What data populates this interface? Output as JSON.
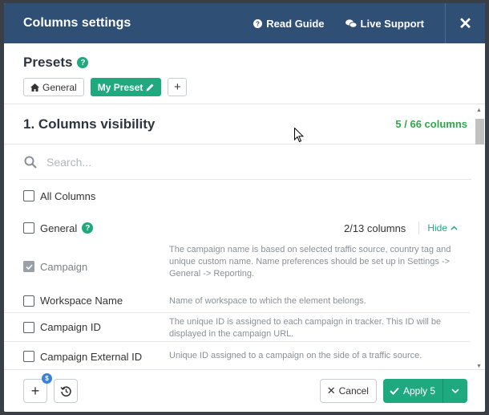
{
  "header": {
    "title": "Columns settings",
    "read_guide": "Read Guide",
    "live_support": "Live Support",
    "close": "✕"
  },
  "presets": {
    "title": "Presets",
    "help": "?",
    "items": [
      {
        "label": "General"
      },
      {
        "label": "My Preset"
      }
    ],
    "add": "+"
  },
  "visibility": {
    "title": "1. Columns visibility",
    "count": "5 / 66 columns",
    "search_placeholder": "Search...",
    "all_columns": "All Columns",
    "group": {
      "label": "General",
      "help": "?",
      "count": "2/13 columns",
      "hide": "Hide"
    },
    "columns": [
      {
        "name": "Campaign",
        "checked": true,
        "description": "The campaign name is based on selected traffic source, country tag and unique custom name. Name preferences should be set up in Settings -> General -> Reporting."
      },
      {
        "name": "Workspace Name",
        "checked": false,
        "description": "Name of workspace to which the element belongs."
      },
      {
        "name": "Campaign ID",
        "checked": false,
        "description": "The unique ID is assigned to each campaign in tracker. This ID will be displayed in the campaign URL."
      },
      {
        "name": "Campaign External ID",
        "checked": false,
        "description": "Unique ID assigned to a campaign on the side of a traffic source."
      }
    ]
  },
  "footer": {
    "add": "+",
    "badge": "$",
    "cancel": "Cancel",
    "apply": "Apply 5"
  },
  "colors": {
    "header_bg": "#2f4f75",
    "accent": "#1fa97e",
    "count_green": "#2ea84a"
  }
}
